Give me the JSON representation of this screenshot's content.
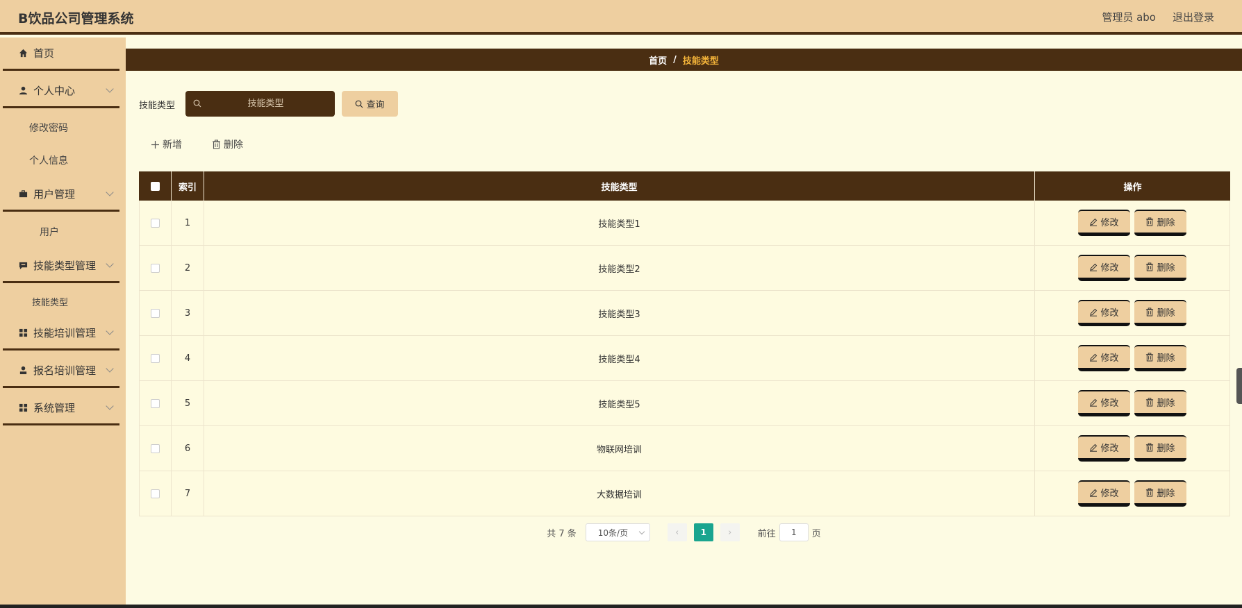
{
  "app": {
    "title": "B饮品公司管理系统",
    "user_label": "管理员 abo",
    "logout_label": "退出登录"
  },
  "sidebar": {
    "items": [
      {
        "label": "首页"
      },
      {
        "label": "个人中心"
      },
      {
        "label": "修改密码"
      },
      {
        "label": "个人信息"
      },
      {
        "label": "用户管理"
      },
      {
        "label": "用户"
      },
      {
        "label": "技能类型管理"
      },
      {
        "label": "技能类型"
      },
      {
        "label": "技能培训管理"
      },
      {
        "label": "报名培训管理"
      },
      {
        "label": "系统管理"
      }
    ]
  },
  "breadcrumb": {
    "home": "首页",
    "sep": "/",
    "current": "技能类型"
  },
  "search": {
    "label": "技能类型",
    "placeholder": "技能类型",
    "query_label": "查询"
  },
  "actions": {
    "add_label": "新增",
    "delete_label": "删除"
  },
  "table": {
    "headers": [
      "索引",
      "技能类型",
      "操作"
    ],
    "rows": [
      {
        "index": "1",
        "name": "技能类型1"
      },
      {
        "index": "2",
        "name": "技能类型2"
      },
      {
        "index": "3",
        "name": "技能类型3"
      },
      {
        "index": "4",
        "name": "技能类型4"
      },
      {
        "index": "5",
        "name": "技能类型5"
      },
      {
        "index": "6",
        "name": "物联网培训"
      },
      {
        "index": "7",
        "name": "大数据培训"
      }
    ],
    "edit_label": "修改",
    "remove_label": "删除"
  },
  "pagination": {
    "total": "共 7 条",
    "page_size": "10条/页",
    "current_page": "1",
    "goto_label": "前往",
    "goto_value": "1",
    "page_suffix": "页"
  },
  "colors": {
    "header_bg": "#eecfa0",
    "dark_brown": "#4a2e12",
    "content_bg": "#fdfbe3",
    "accent_orange": "#f5b53a",
    "page_active": "#1aa58f"
  }
}
